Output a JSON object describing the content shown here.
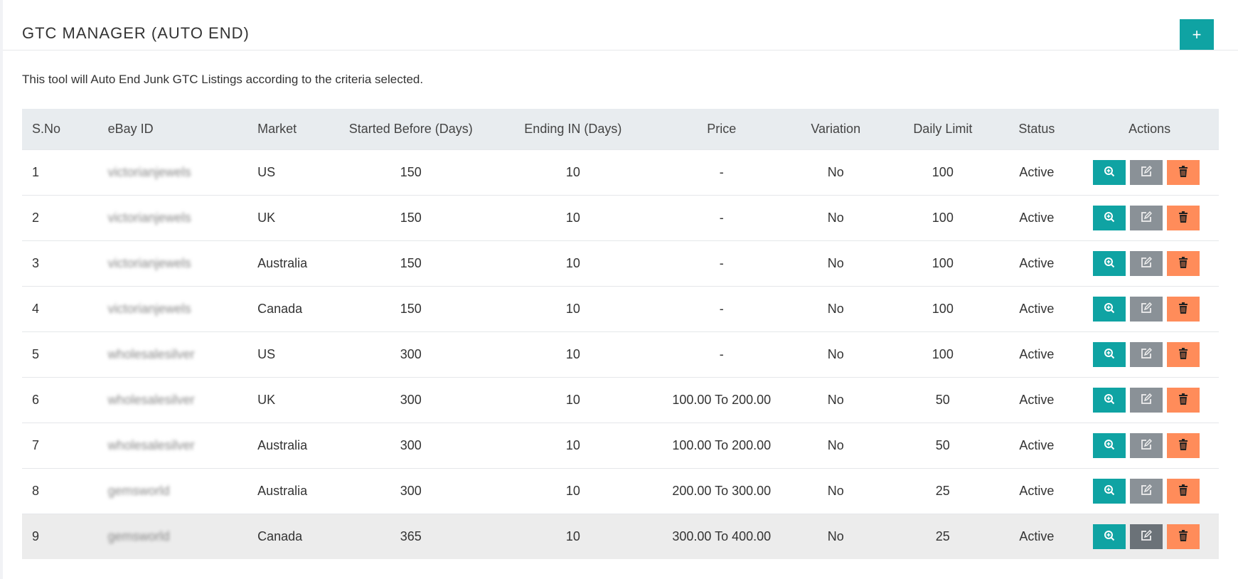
{
  "header": {
    "title": "GTC MANAGER (AUTO END)",
    "add_label": "+"
  },
  "description": "This tool will Auto End Junk GTC Listings according to the criteria selected.",
  "table": {
    "columns": [
      "S.No",
      "eBay ID",
      "Market",
      "Started Before (Days)",
      "Ending IN (Days)",
      "Price",
      "Variation",
      "Daily Limit",
      "Status",
      "Actions"
    ],
    "rows": [
      {
        "sno": "1",
        "ebay_id": "victorianjewels",
        "market": "US",
        "started": "150",
        "ending": "10",
        "price": "-",
        "variation": "No",
        "limit": "100",
        "status": "Active"
      },
      {
        "sno": "2",
        "ebay_id": "victorianjewels",
        "market": "UK",
        "started": "150",
        "ending": "10",
        "price": "-",
        "variation": "No",
        "limit": "100",
        "status": "Active"
      },
      {
        "sno": "3",
        "ebay_id": "victorianjewels",
        "market": "Australia",
        "started": "150",
        "ending": "10",
        "price": "-",
        "variation": "No",
        "limit": "100",
        "status": "Active"
      },
      {
        "sno": "4",
        "ebay_id": "victorianjewels",
        "market": "Canada",
        "started": "150",
        "ending": "10",
        "price": "-",
        "variation": "No",
        "limit": "100",
        "status": "Active"
      },
      {
        "sno": "5",
        "ebay_id": "wholesalesilver",
        "market": "US",
        "started": "300",
        "ending": "10",
        "price": "-",
        "variation": "No",
        "limit": "100",
        "status": "Active"
      },
      {
        "sno": "6",
        "ebay_id": "wholesalesilver",
        "market": "UK",
        "started": "300",
        "ending": "10",
        "price": "100.00 To 200.00",
        "variation": "No",
        "limit": "50",
        "status": "Active"
      },
      {
        "sno": "7",
        "ebay_id": "wholesalesilver",
        "market": "Australia",
        "started": "300",
        "ending": "10",
        "price": "100.00 To 200.00",
        "variation": "No",
        "limit": "50",
        "status": "Active"
      },
      {
        "sno": "8",
        "ebay_id": "gemsworld",
        "market": "Australia",
        "started": "300",
        "ending": "10",
        "price": "200.00 To 300.00",
        "variation": "No",
        "limit": "25",
        "status": "Active"
      },
      {
        "sno": "9",
        "ebay_id": "gemsworld",
        "market": "Canada",
        "started": "365",
        "ending": "10",
        "price": "300.00 To 400.00",
        "variation": "No",
        "limit": "25",
        "status": "Active"
      }
    ],
    "actions": [
      "view-icon",
      "edit-icon",
      "delete-icon"
    ]
  },
  "colors": {
    "primary": "#0fa3a3",
    "edit": "#8a9197",
    "delete": "#ff8c5a"
  }
}
